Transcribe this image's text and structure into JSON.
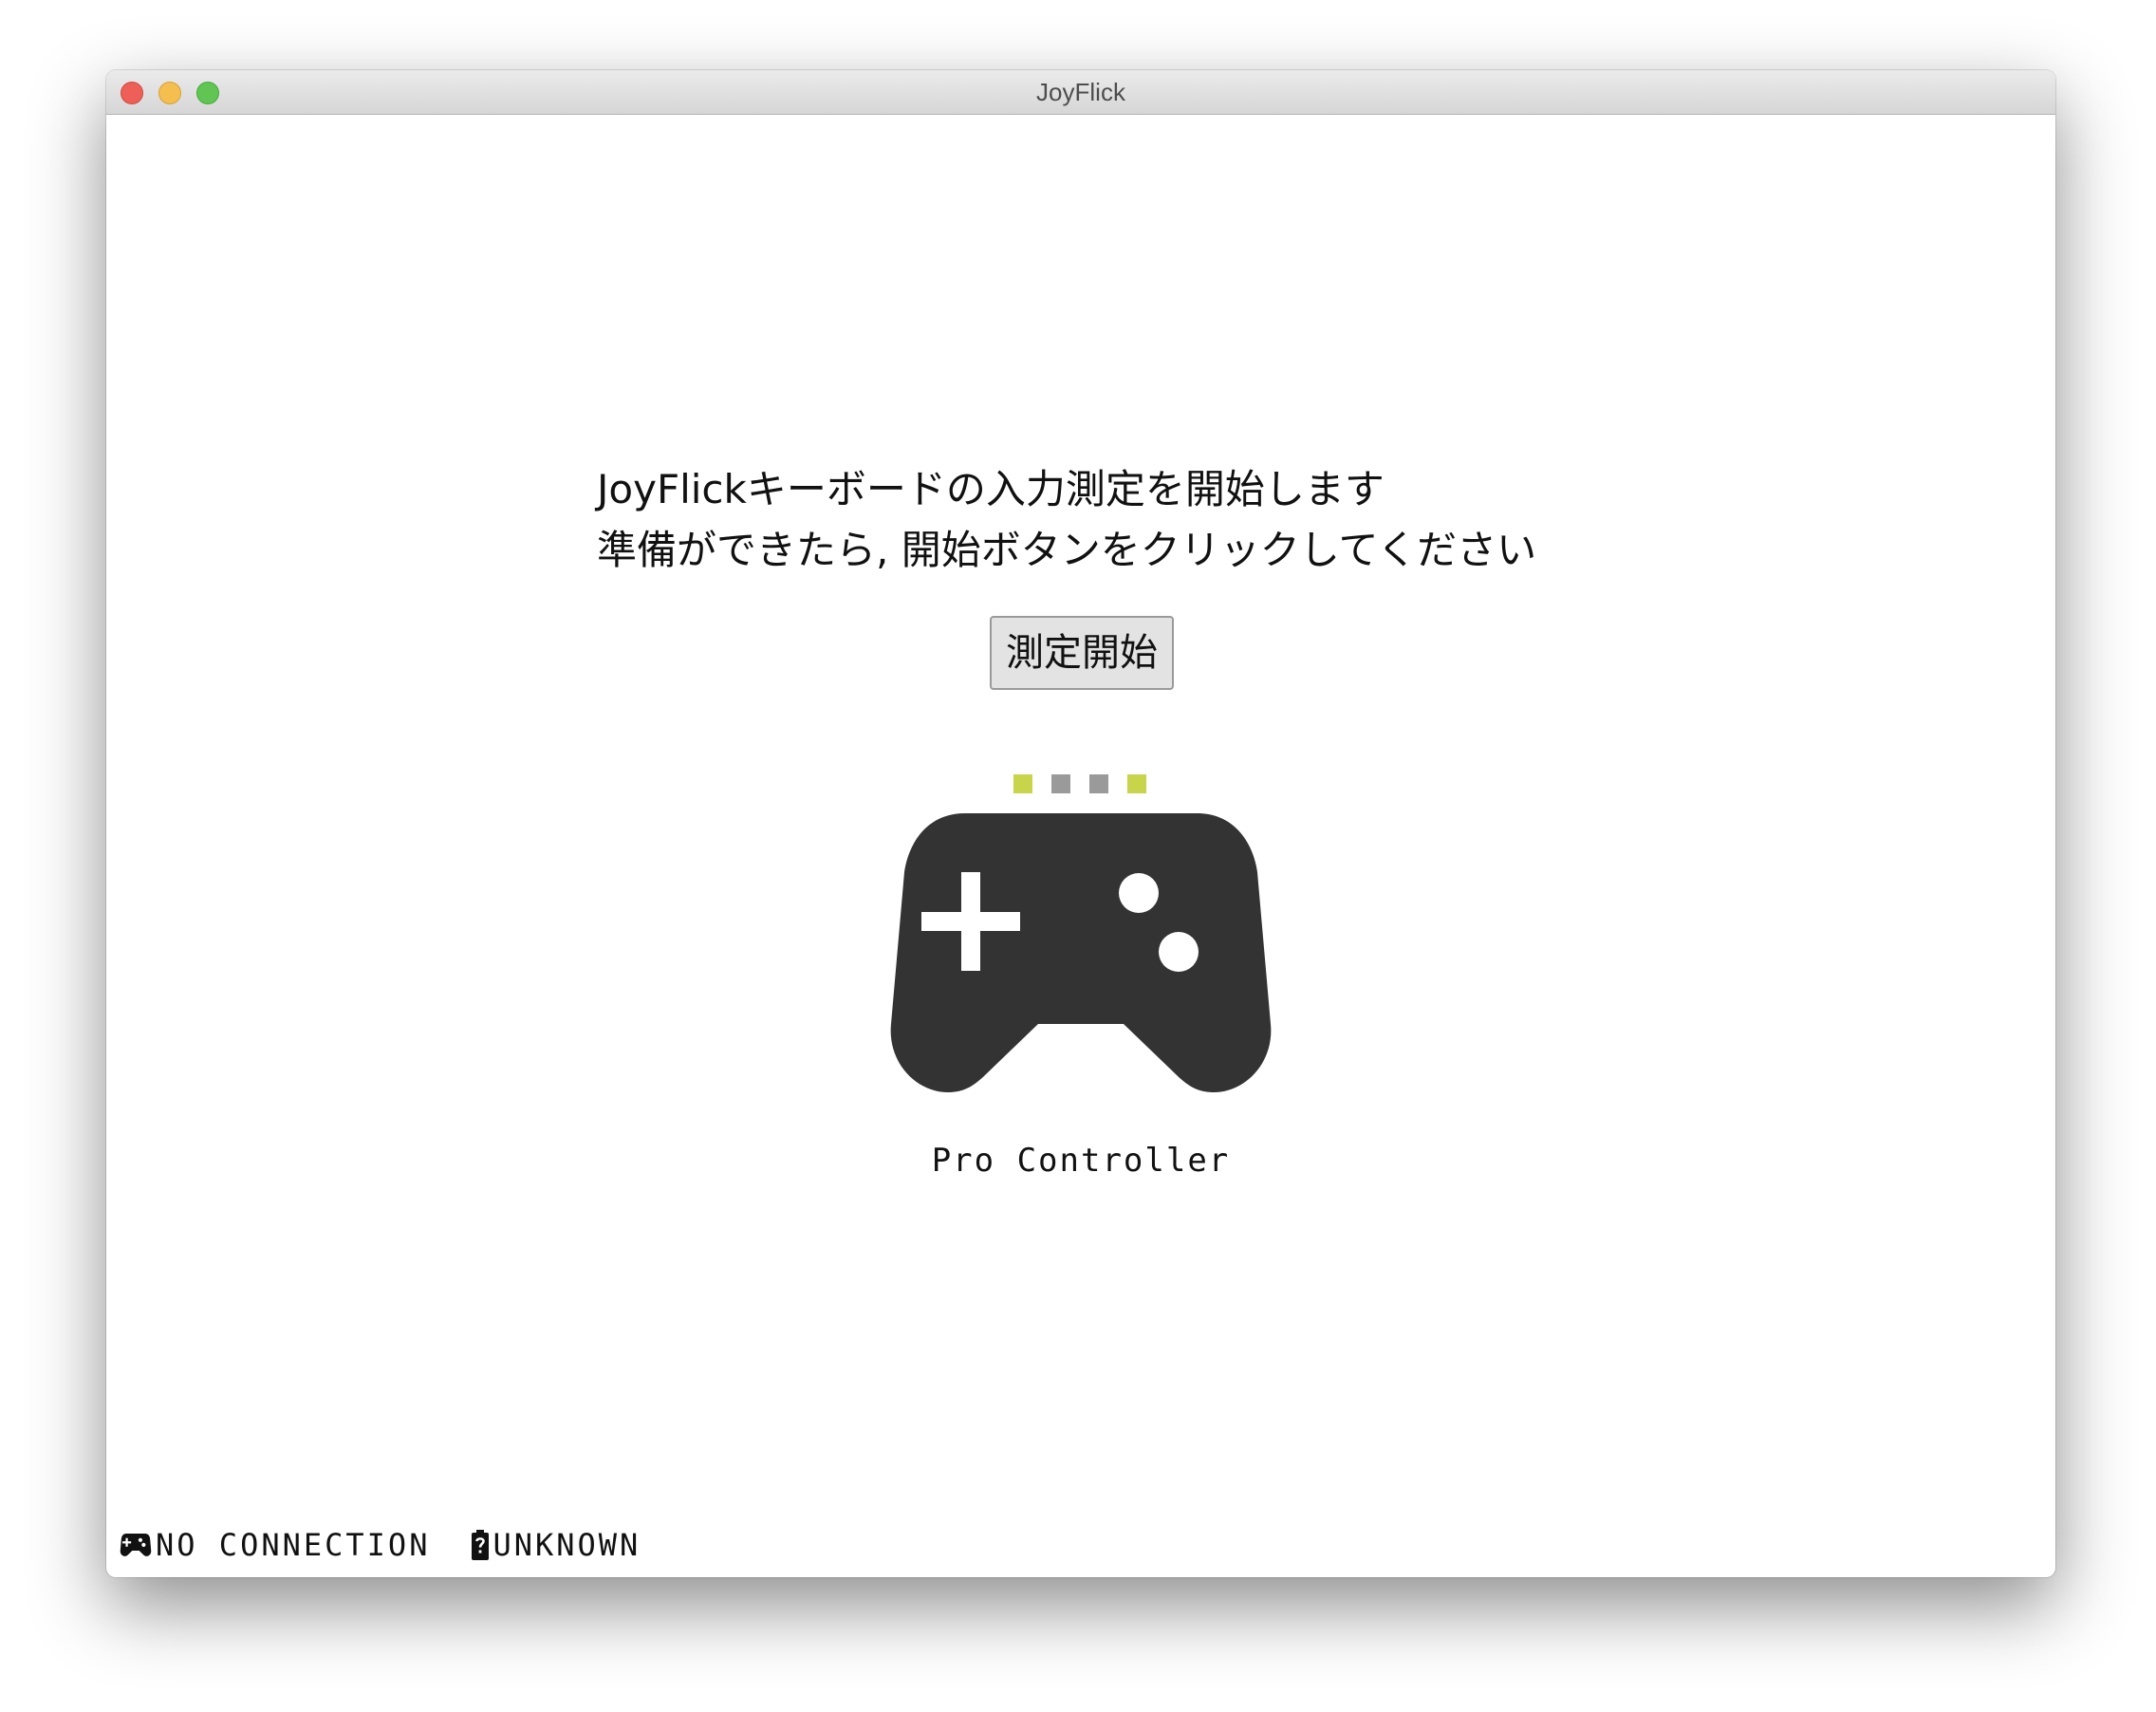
{
  "window": {
    "title": "JoyFlick"
  },
  "main": {
    "intro_line1": "JoyFlickキーボードの入力測定を開始します",
    "intro_line2": "準備ができたら, 開始ボタンをクリックしてください",
    "start_button": "測定開始",
    "player_leds": [
      {
        "state": "on",
        "color": "#c8d44a"
      },
      {
        "state": "off",
        "color": "#9a9a9a"
      },
      {
        "state": "off",
        "color": "#9a9a9a"
      },
      {
        "state": "on",
        "color": "#c8d44a"
      }
    ],
    "controller_icon": "gamepad-icon",
    "controller_icon_color": "#333333",
    "controller_name": "Pro Controller"
  },
  "statusbar": {
    "connection_icon": "gamepad-icon",
    "connection": "NO CONNECTION",
    "battery_icon": "battery-unknown-icon",
    "battery": "UNKNOWN"
  }
}
